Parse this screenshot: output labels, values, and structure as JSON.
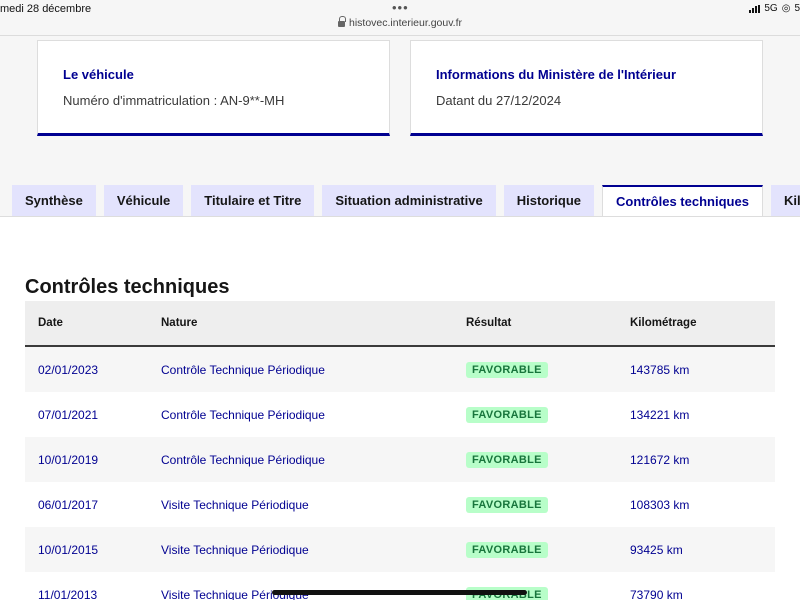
{
  "status_bar": {
    "time": "medi 28 décembre",
    "dots": "•••",
    "url": "histovec.interieur.gouv.fr",
    "network": "5G",
    "battery": "5"
  },
  "cards": [
    {
      "title": "Le véhicule",
      "text": "Numéro d'immatriculation : AN-9**-MH"
    },
    {
      "title": "Informations du Ministère de l'Intérieur",
      "text": "Datant du 27/12/2024"
    }
  ],
  "tabs": [
    {
      "label": "Synthèse"
    },
    {
      "label": "Véhicule"
    },
    {
      "label": "Titulaire et Titre"
    },
    {
      "label": "Situation administrative"
    },
    {
      "label": "Historique"
    },
    {
      "label": "Contrôles techniques"
    },
    {
      "label": "Kilo"
    }
  ],
  "active_tab": "Contrôles techniques",
  "section_title": "Contrôles techniques",
  "table": {
    "headers": [
      "Date",
      "Nature",
      "Résultat",
      "Kilométrage"
    ],
    "rows": [
      {
        "date": "02/01/2023",
        "nature": "Contrôle Technique Périodique",
        "result": "FAVORABLE",
        "km": "143785 km"
      },
      {
        "date": "07/01/2021",
        "nature": "Contrôle Technique Périodique",
        "result": "FAVORABLE",
        "km": "134221 km"
      },
      {
        "date": "10/01/2019",
        "nature": "Contrôle Technique Périodique",
        "result": "FAVORABLE",
        "km": "121672 km"
      },
      {
        "date": "06/01/2017",
        "nature": "Visite Technique Périodique",
        "result": "FAVORABLE",
        "km": "108303 km"
      },
      {
        "date": "10/01/2015",
        "nature": "Visite Technique Périodique",
        "result": "FAVORABLE",
        "km": "93425 km"
      },
      {
        "date": "11/01/2013",
        "nature": "Visite Technique Périodique",
        "result": "FAVORABLE",
        "km": "73790 km"
      }
    ]
  },
  "colors": {
    "accent": "#000091",
    "badge_bg": "#b8fec9",
    "badge_text": "#18753c",
    "tab_bg": "#e3e3fd"
  }
}
